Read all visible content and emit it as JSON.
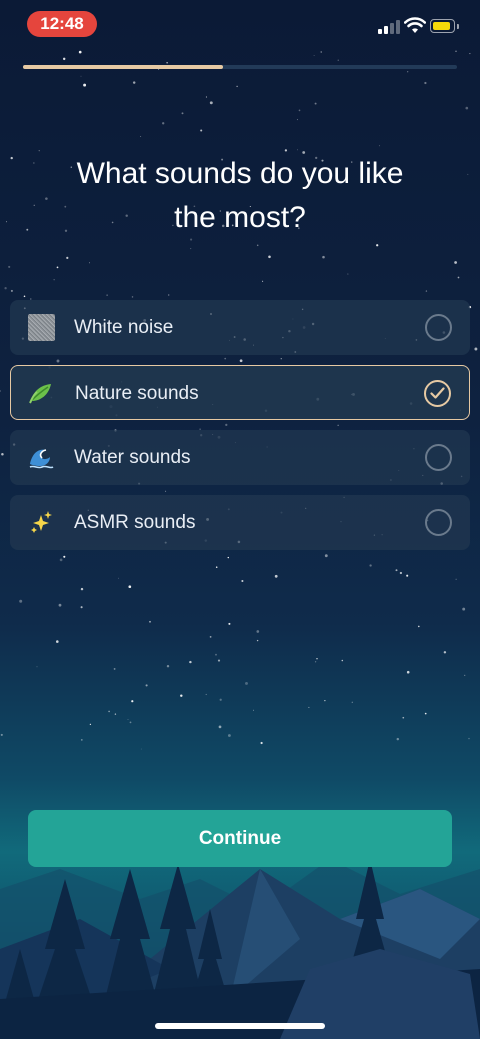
{
  "status_bar": {
    "time": "12:48",
    "signal_icon": "cellular-signal-icon",
    "wifi_icon": "wifi-icon",
    "battery_icon": "battery-icon",
    "battery_color": "#f5d90a",
    "time_pill_color": "#e5453d"
  },
  "progress": {
    "fraction": 0.46,
    "fill_color": "#e6c9a3"
  },
  "question": {
    "line1": "What sounds do you like",
    "line2": "the most?"
  },
  "options": [
    {
      "label": "White noise",
      "icon": "white-noise-icon",
      "selected": false
    },
    {
      "label": "Nature sounds",
      "icon": "leaf-icon",
      "selected": true
    },
    {
      "label": "Water sounds",
      "icon": "wave-icon",
      "selected": false
    },
    {
      "label": "ASMR sounds",
      "icon": "sparkles-icon",
      "selected": false
    }
  ],
  "continue_button": {
    "label": "Continue",
    "color": "#23a497"
  },
  "colors": {
    "accent": "#e6c9a3",
    "background": "#0c1b36"
  }
}
